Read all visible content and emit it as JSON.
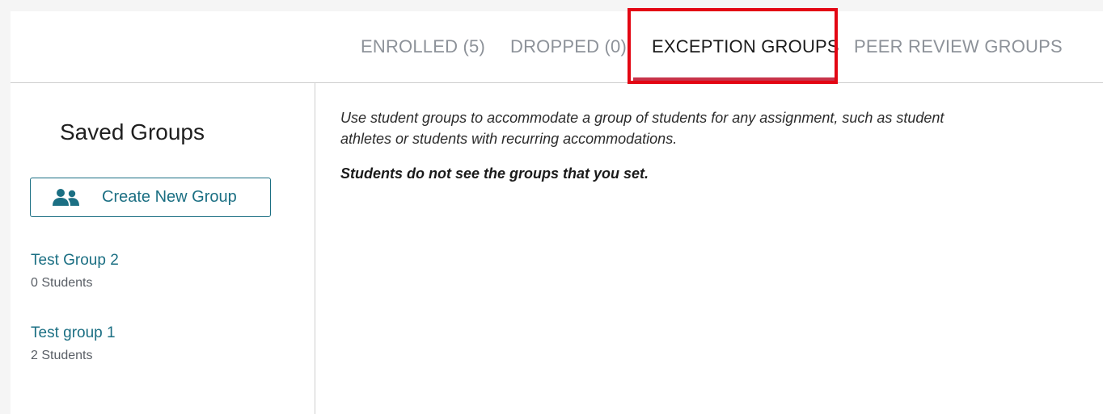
{
  "tabs": [
    {
      "label": "ENROLLED (5)",
      "active": false
    },
    {
      "label": "DROPPED (0)",
      "active": false
    },
    {
      "label": "EXCEPTION GROUPS",
      "active": true
    },
    {
      "label": "PEER REVIEW GROUPS",
      "active": false
    }
  ],
  "sidebar": {
    "title": "Saved Groups",
    "create_button": {
      "label": "Create New Group",
      "icon": "group-icon"
    },
    "groups": [
      {
        "name": "Test Group 2",
        "count": "0 Students"
      },
      {
        "name": "Test group 1",
        "count": "2 Students"
      }
    ]
  },
  "main": {
    "intro": "Use student groups to accommodate a group of students for any assignment, such as student athletes or students with recurring accommodations.",
    "note": "Students do not see the groups that you set."
  },
  "colors": {
    "accent": "#1b6f83",
    "active_tab_underline": "#c8334a",
    "highlight": "#e30613"
  }
}
